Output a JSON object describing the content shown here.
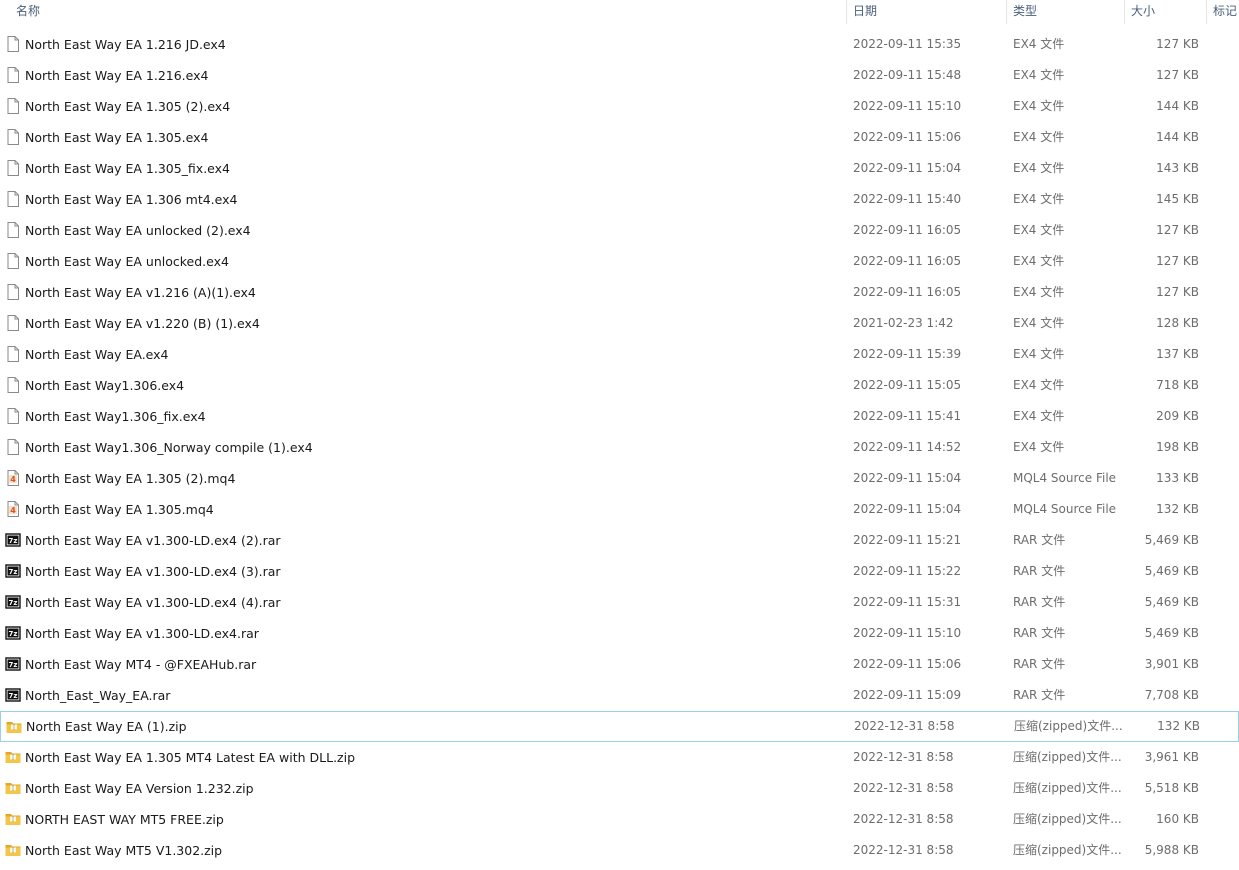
{
  "columns": {
    "name": "名称",
    "date": "日期",
    "type": "类型",
    "size": "大小",
    "tags": "标记"
  },
  "files": [
    {
      "name": "North East Way EA 1.216 JD.ex4",
      "date": "2022-09-11 15:35",
      "type": "EX4 文件",
      "size": "127 KB",
      "icon": "file-icon"
    },
    {
      "name": "North East Way EA 1.216.ex4",
      "date": "2022-09-11 15:48",
      "type": "EX4 文件",
      "size": "127 KB",
      "icon": "file-icon"
    },
    {
      "name": "North East Way EA 1.305 (2).ex4",
      "date": "2022-09-11 15:10",
      "type": "EX4 文件",
      "size": "144 KB",
      "icon": "file-icon"
    },
    {
      "name": "North East Way EA 1.305.ex4",
      "date": "2022-09-11 15:06",
      "type": "EX4 文件",
      "size": "144 KB",
      "icon": "file-icon"
    },
    {
      "name": "North East Way EA 1.305_fix.ex4",
      "date": "2022-09-11 15:04",
      "type": "EX4 文件",
      "size": "143 KB",
      "icon": "file-icon"
    },
    {
      "name": "North East Way EA 1.306 mt4.ex4",
      "date": "2022-09-11 15:40",
      "type": "EX4 文件",
      "size": "145 KB",
      "icon": "file-icon"
    },
    {
      "name": "North East Way EA unlocked (2).ex4",
      "date": "2022-09-11 16:05",
      "type": "EX4 文件",
      "size": "127 KB",
      "icon": "file-icon"
    },
    {
      "name": "North East Way EA unlocked.ex4",
      "date": "2022-09-11 16:05",
      "type": "EX4 文件",
      "size": "127 KB",
      "icon": "file-icon"
    },
    {
      "name": "North East Way EA v1.216 (A)(1).ex4",
      "date": "2022-09-11 16:05",
      "type": "EX4 文件",
      "size": "127 KB",
      "icon": "file-icon"
    },
    {
      "name": "North East Way EA v1.220 (B) (1).ex4",
      "date": "2021-02-23 1:42",
      "type": "EX4 文件",
      "size": "128 KB",
      "icon": "file-icon"
    },
    {
      "name": "North East Way EA.ex4",
      "date": "2022-09-11 15:39",
      "type": "EX4 文件",
      "size": "137 KB",
      "icon": "file-icon"
    },
    {
      "name": "North East Way1.306.ex4",
      "date": "2022-09-11 15:05",
      "type": "EX4 文件",
      "size": "718 KB",
      "icon": "file-icon"
    },
    {
      "name": "North East Way1.306_fix.ex4",
      "date": "2022-09-11 15:41",
      "type": "EX4 文件",
      "size": "209 KB",
      "icon": "file-icon"
    },
    {
      "name": "North East Way1.306_Norway compile (1).ex4",
      "date": "2022-09-11 14:52",
      "type": "EX4 文件",
      "size": "198 KB",
      "icon": "file-icon"
    },
    {
      "name": "North East Way EA 1.305 (2).mq4",
      "date": "2022-09-11 15:04",
      "type": "MQL4 Source File",
      "size": "133 KB",
      "icon": "mq4-file-icon"
    },
    {
      "name": "North East Way EA 1.305.mq4",
      "date": "2022-09-11 15:04",
      "type": "MQL4 Source File",
      "size": "132 KB",
      "icon": "mq4-file-icon"
    },
    {
      "name": "North East Way EA v1.300-LD.ex4 (2).rar",
      "date": "2022-09-11 15:21",
      "type": "RAR 文件",
      "size": "5,469 KB",
      "icon": "7z-archive-icon"
    },
    {
      "name": "North East Way EA v1.300-LD.ex4 (3).rar",
      "date": "2022-09-11 15:22",
      "type": "RAR 文件",
      "size": "5,469 KB",
      "icon": "7z-archive-icon"
    },
    {
      "name": "North East Way EA v1.300-LD.ex4 (4).rar",
      "date": "2022-09-11 15:31",
      "type": "RAR 文件",
      "size": "5,469 KB",
      "icon": "7z-archive-icon"
    },
    {
      "name": "North East Way EA v1.300-LD.ex4.rar",
      "date": "2022-09-11 15:10",
      "type": "RAR 文件",
      "size": "5,469 KB",
      "icon": "7z-archive-icon"
    },
    {
      "name": "North East Way MT4 - @FXEAHub.rar",
      "date": "2022-09-11 15:06",
      "type": "RAR 文件",
      "size": "3,901 KB",
      "icon": "7z-archive-icon"
    },
    {
      "name": "North_East_Way_EA.rar",
      "date": "2022-09-11 15:09",
      "type": "RAR 文件",
      "size": "7,708 KB",
      "icon": "7z-archive-icon"
    },
    {
      "name": "North East Way EA (1).zip",
      "date": "2022-12-31 8:58",
      "type": "压缩(zipped)文件...",
      "size": "132 KB",
      "icon": "zip-folder-icon"
    },
    {
      "name": "North East Way EA 1.305 MT4 Latest EA with DLL.zip",
      "date": "2022-12-31 8:58",
      "type": "压缩(zipped)文件...",
      "size": "3,961 KB",
      "icon": "zip-folder-icon"
    },
    {
      "name": "North East Way EA Version 1.232.zip",
      "date": "2022-12-31 8:58",
      "type": "压缩(zipped)文件...",
      "size": "5,518 KB",
      "icon": "zip-folder-icon"
    },
    {
      "name": "NORTH EAST WAY MT5 FREE.zip",
      "date": "2022-12-31 8:58",
      "type": "压缩(zipped)文件...",
      "size": "160 KB",
      "icon": "zip-folder-icon"
    },
    {
      "name": "North East Way MT5 V1.302.zip",
      "date": "2022-12-31 8:58",
      "type": "压缩(zipped)文件...",
      "size": "5,988 KB",
      "icon": "zip-folder-icon"
    }
  ],
  "focused_index": 22,
  "colors": {
    "header_text": "#4c607a",
    "focus_border": "#99d1e8",
    "secondary_text": "#6d6d6d",
    "zip_folder": "#f3c548"
  }
}
